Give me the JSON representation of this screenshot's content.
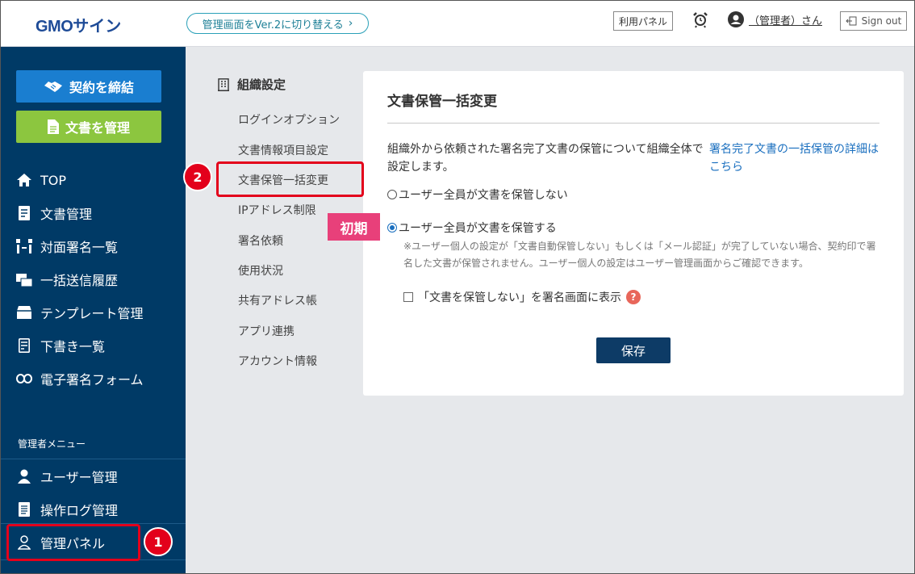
{
  "header": {
    "logo_prefix": "GMO",
    "logo_suffix": "サイン",
    "version_switch": "管理画面をVer.2に切り替える",
    "usage_panel": "利用パネル",
    "user_name": "（管理者）さん",
    "sign_out": "Sign out"
  },
  "sidebar": {
    "cta_sign": "契約を締結",
    "cta_doc": "文書を管理",
    "items": [
      {
        "label": "TOP"
      },
      {
        "label": "文書管理"
      },
      {
        "label": "対面署名一覧"
      },
      {
        "label": "一括送信履歴"
      },
      {
        "label": "テンプレート管理"
      },
      {
        "label": "下書き一覧"
      },
      {
        "label": "電子署名フォーム"
      }
    ],
    "admin_label": "管理者メニュー",
    "admin_items": [
      {
        "label": "ユーザー管理"
      },
      {
        "label": "操作ログ管理"
      },
      {
        "label": "管理パネル"
      }
    ]
  },
  "submenu": {
    "title": "組織設定",
    "items": [
      {
        "label": "ログインオプション"
      },
      {
        "label": "文書情報項目設定"
      },
      {
        "label": "文書保管一括変更"
      },
      {
        "label": "IPアドレス制限"
      },
      {
        "label": "署名依頼"
      },
      {
        "label": "使用状況"
      },
      {
        "label": "共有アドレス帳"
      },
      {
        "label": "アプリ連携"
      },
      {
        "label": "アカウント情報"
      }
    ]
  },
  "panel": {
    "title": "文書保管一括変更",
    "description": "組織外から依頼された署名完了文書の保管について組織全体で設定します。",
    "link": "署名完了文書の一括保管の詳細はこちら",
    "option_no_store": "ユーザー全員が文書を保管しない",
    "option_store": "ユーザー全員が文書を保管する",
    "note": "※ユーザー個人の設定が「文書自動保管しない」もしくは「メール認証」が完了していない場合、契約印で署名した文書が保管されません。ユーザー個人の設定はユーザー管理画面からご確認できます。",
    "checkbox_label": "「文書を保管しない」を署名画面に表示",
    "help": "?",
    "save": "保存"
  },
  "annotations": {
    "badge1": "1",
    "badge2": "2",
    "initial_tag": "初期"
  }
}
